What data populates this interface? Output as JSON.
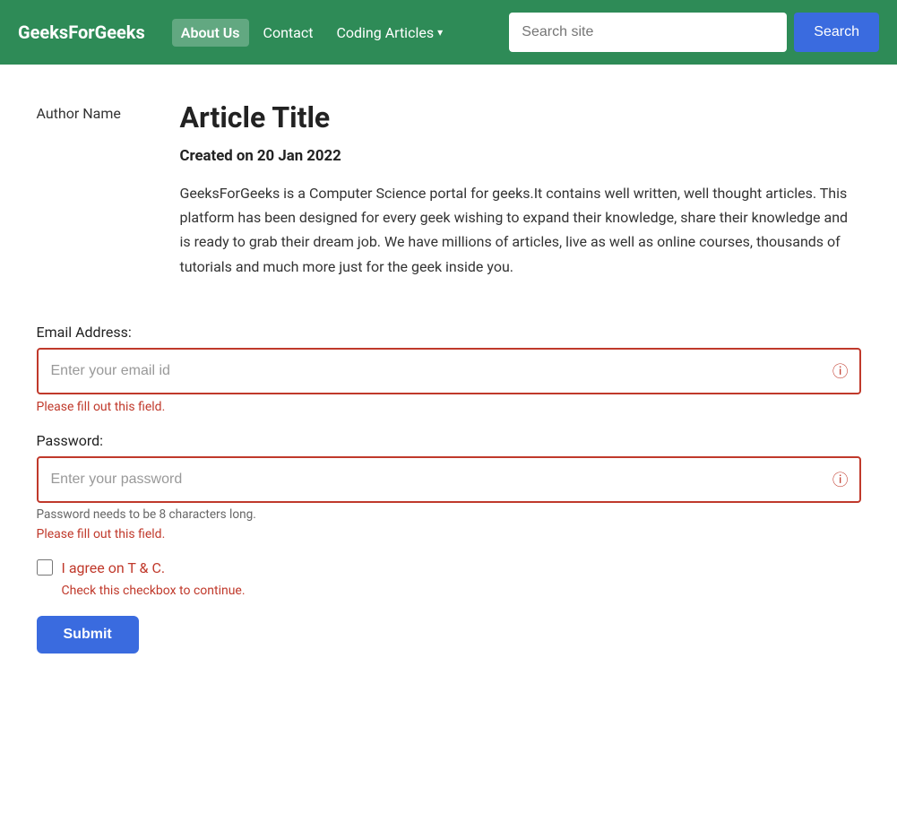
{
  "nav": {
    "logo": "GeeksForGeeks",
    "links": [
      {
        "label": "About Us",
        "active": true,
        "dropdown": false
      },
      {
        "label": "Contact",
        "active": false,
        "dropdown": false
      },
      {
        "label": "Coding Articles",
        "active": false,
        "dropdown": true
      }
    ],
    "search": {
      "placeholder": "Search site",
      "button_label": "Search"
    }
  },
  "article": {
    "author": "Author Name",
    "title": "Article Title",
    "date": "Created on 20 Jan 2022",
    "body": "GeeksForGeeks is a Computer Science portal for geeks.It contains well written, well thought articles. This platform has been designed for every geek wishing to expand their knowledge, share their knowledge and is ready to grab their dream job. We have millions of articles, live as well as online courses, thousands of tutorials and much more just for the geek inside you."
  },
  "form": {
    "email_label": "Email Address:",
    "email_placeholder": "Enter your email id",
    "email_error": "Please fill out this field.",
    "password_label": "Password:",
    "password_placeholder": "Enter your password",
    "password_hint": "Password needs to be 8 characters long.",
    "password_error": "Please fill out this field.",
    "checkbox_label": "I agree on T & C.",
    "checkbox_error": "Check this checkbox to continue.",
    "submit_label": "Submit"
  }
}
